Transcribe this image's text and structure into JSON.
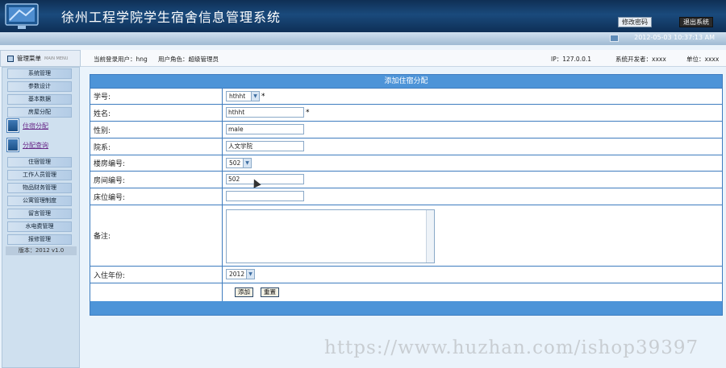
{
  "app": {
    "title": "徐州工程学院学生宿舍信息管理系统"
  },
  "top_buttons": {
    "change_password": "修改密码",
    "logout": "退出系统"
  },
  "status": {
    "datetime": "2012-05-03 10:37:13 AM"
  },
  "menu": {
    "title": "管理菜单",
    "subtitle": "MAIN MENU"
  },
  "info": {
    "current_user": "当前登录用户：hng",
    "role": "用户角色：超级管理员",
    "ip": "IP：127.0.0.1",
    "developer": "系统开发者：xxxx",
    "unit": "单位：xxxx"
  },
  "sidebar": {
    "top_items": [
      "系统管理",
      "参数设计",
      "基本数据",
      "房屋分配"
    ],
    "links": [
      "住宿分配",
      "分配查询"
    ],
    "bottom_items": [
      "住宿管理",
      "工作人员管理",
      "物品财务管理",
      "公寓管理制度",
      "留言管理",
      "水电费管理",
      "报修管理"
    ],
    "version": "版本：2012 v1.0"
  },
  "form": {
    "title": "添加住宿分配",
    "labels": {
      "student_id": "学号:",
      "name": "姓名:",
      "gender": "性别:",
      "department": "院系:",
      "building": "楼房编号:",
      "room": "房间编号:",
      "bed": "床位编号:",
      "remark": "备注:",
      "year": "入住年份:"
    },
    "values": {
      "student_id": "hthht",
      "name": "hthht",
      "gender": "male",
      "department": "人文学院",
      "building": "502",
      "room": "502",
      "bed": "",
      "remark": "",
      "year": "2012"
    },
    "required_mark": "*",
    "buttons": {
      "add": "添加",
      "reset": "重置"
    }
  },
  "watermark": "https://www.huzhan.com/ishop39397"
}
